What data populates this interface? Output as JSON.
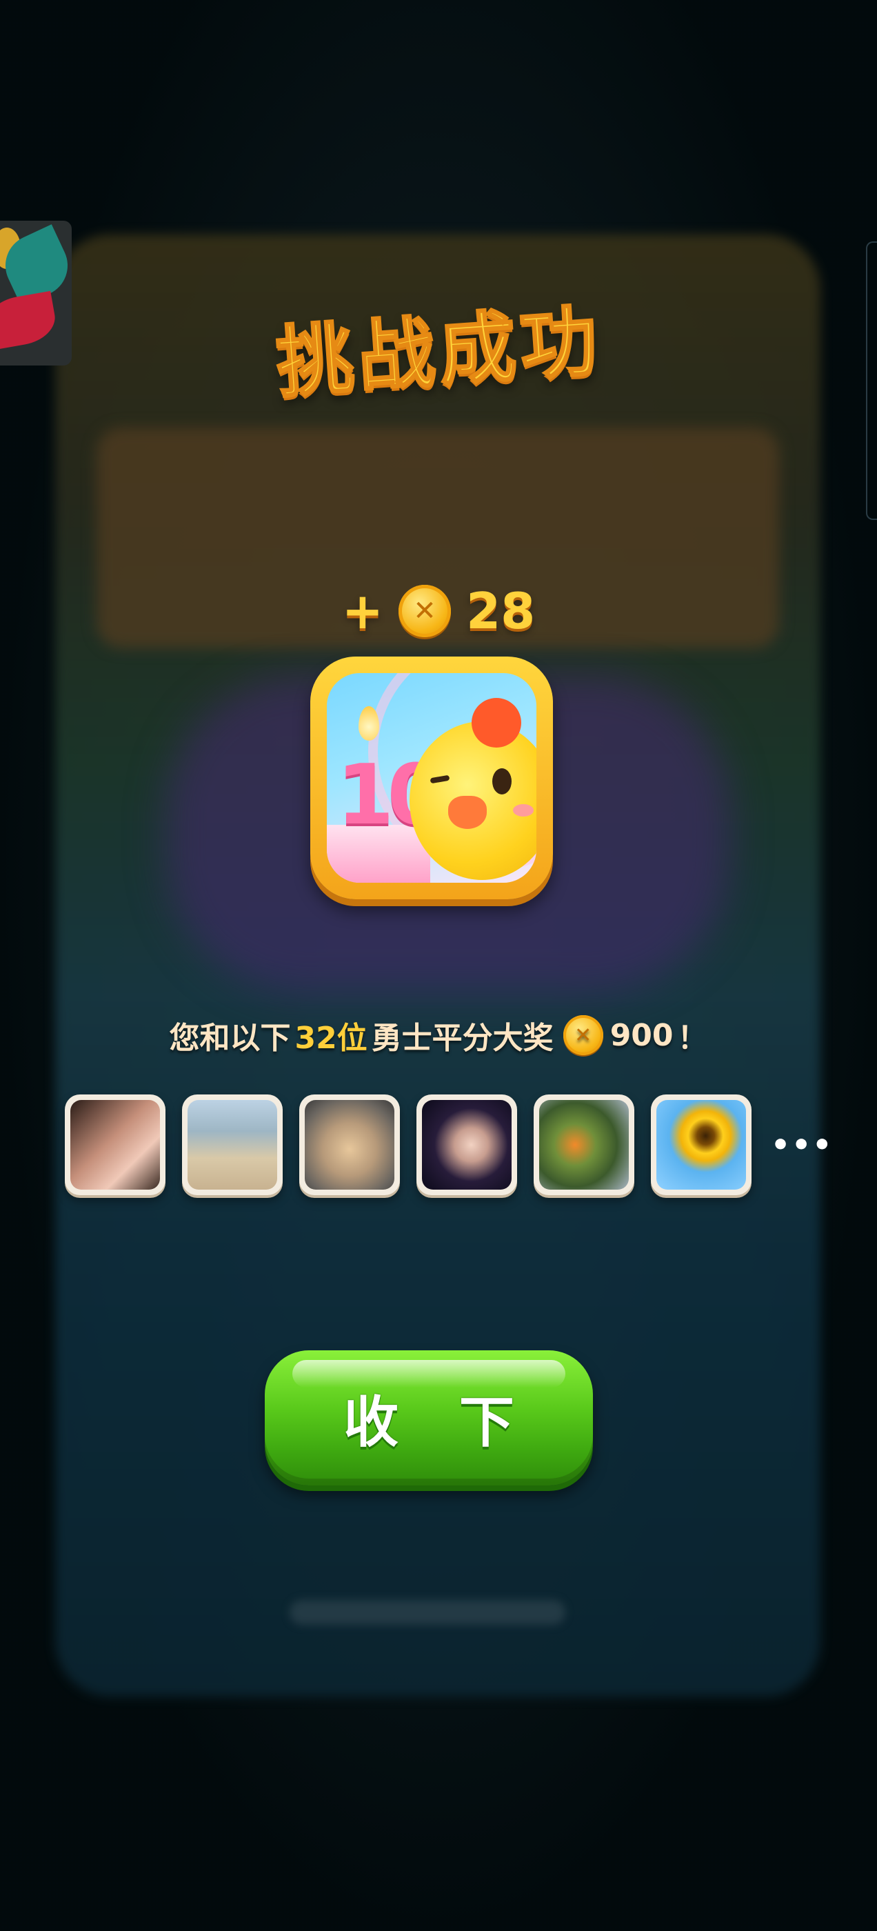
{
  "modal": {
    "title": "挑战成功",
    "reward": {
      "plus": "+",
      "amount": "28",
      "coin_icon": "coin-icon"
    },
    "app_icon": {
      "icon": "chick-birthday-icon",
      "candle_number": "10"
    },
    "share_text": {
      "prefix": "您和以下",
      "count": "32位",
      "middle": "勇士平分大奖",
      "prize": "900",
      "suffix": "！"
    },
    "participants": [
      {
        "avatar": "avatar-1"
      },
      {
        "avatar": "avatar-2"
      },
      {
        "avatar": "avatar-3"
      },
      {
        "avatar": "avatar-4"
      },
      {
        "avatar": "avatar-5"
      },
      {
        "avatar": "avatar-6"
      }
    ],
    "more_indicator": "•••",
    "collect_button": "收 下"
  },
  "colors": {
    "gold": "#ffd23c",
    "green_button": "#58c81a",
    "highlight": "#ffcf3a",
    "text_light": "#ffe6c4"
  }
}
